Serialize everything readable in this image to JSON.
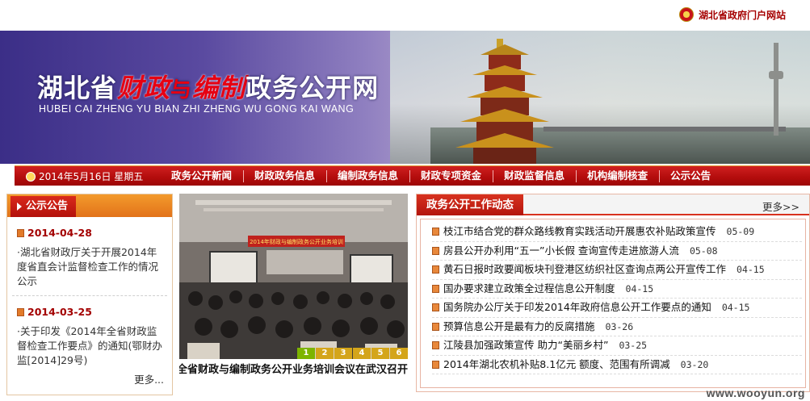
{
  "header": {
    "portal_link": "湖北省政府门户网站",
    "title_part1": "湖北省",
    "title_red1": "财政",
    "title_join": "与",
    "title_red2": "编制",
    "title_part2": "政务公开网",
    "subtitle": "HUBEI CAI ZHENG YU BIAN ZHI ZHENG WU GONG KAI WANG"
  },
  "nav": {
    "date": "2014年5月16日  星期五",
    "items": [
      "政务公开新闻",
      "财政政务信息",
      "编制政务信息",
      "财政专项资金",
      "财政监督信息",
      "机构编制核查",
      "公示公告"
    ]
  },
  "notice": {
    "title": "公示公告",
    "entries": [
      {
        "date": "2014-04-28",
        "text": "·湖北省财政厅关于开展2014年度省直会计监督检查工作的情况公示"
      },
      {
        "date": "2014-03-25",
        "text": "·关于印发《2014年全省财政监督检查工作要点》的通知(鄂财办监[2014]29号)"
      }
    ],
    "more": "更多..."
  },
  "photo": {
    "banner_text": "2014年财政与编制政务公开业务培训",
    "caption": "全省财政与编制政务公开业务培训会议在武汉召开",
    "pages": [
      "1",
      "2",
      "3",
      "4",
      "5",
      "6"
    ],
    "active_page": 1
  },
  "news": {
    "title": "政务公开工作动态",
    "more": "更多>>",
    "items": [
      {
        "text": "枝江市结合党的群众路线教育实践活动开展惠农补贴政策宣传",
        "date": "05-09"
      },
      {
        "text": "房县公开办利用“五一”小长假 查询宣传走进旅游人流",
        "date": "05-08"
      },
      {
        "text": "黄石日报时政要闻板块刊登港区纺织社区查询点两公开宣传工作",
        "date": "04-15"
      },
      {
        "text": "国办要求建立政策全过程信息公开制度",
        "date": "04-15"
      },
      {
        "text": "国务院办公厅关于印发2014年政府信息公开工作要点的通知",
        "date": "04-15"
      },
      {
        "text": "预算信息公开是最有力的反腐措施",
        "date": "03-26"
      },
      {
        "text": "江陵县加强政策宣传 助力“美丽乡村”",
        "date": "03-25"
      },
      {
        "text": "2014年湖北农机补贴8.1亿元 额度、范围有所调减",
        "date": "03-20"
      }
    ]
  },
  "watermark": "www.wooyun.org",
  "colors": {
    "brand_red": "#b20c0c",
    "orange": "#e2731a",
    "banner_purple": "#3b2e87"
  }
}
